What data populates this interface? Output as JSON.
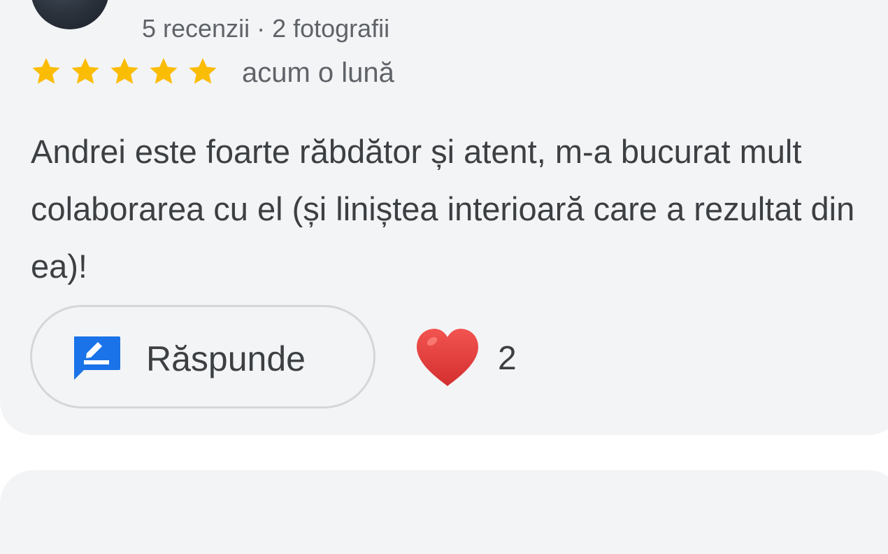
{
  "review": {
    "author_meta": "5 recenzii · 2 fotografii",
    "rating": 5,
    "rating_max": 5,
    "date": "acum o lună",
    "text": "Andrei este foarte răbdător și atent, m-a bucurat mult colaborarea cu el (și liniștea interioară care a rezultat din ea)!",
    "reply_label": "Răspunde",
    "like_count": "2"
  },
  "icons": {
    "star": "star-icon",
    "reply": "reply-icon",
    "like": "heart-icon"
  },
  "colors": {
    "card_background": "#f3f4f6",
    "star": "#fbbc04",
    "reply_icon": "#1a73e8",
    "heart": "#e53935",
    "text": "#3c4043",
    "secondary_text": "#5f6368"
  }
}
